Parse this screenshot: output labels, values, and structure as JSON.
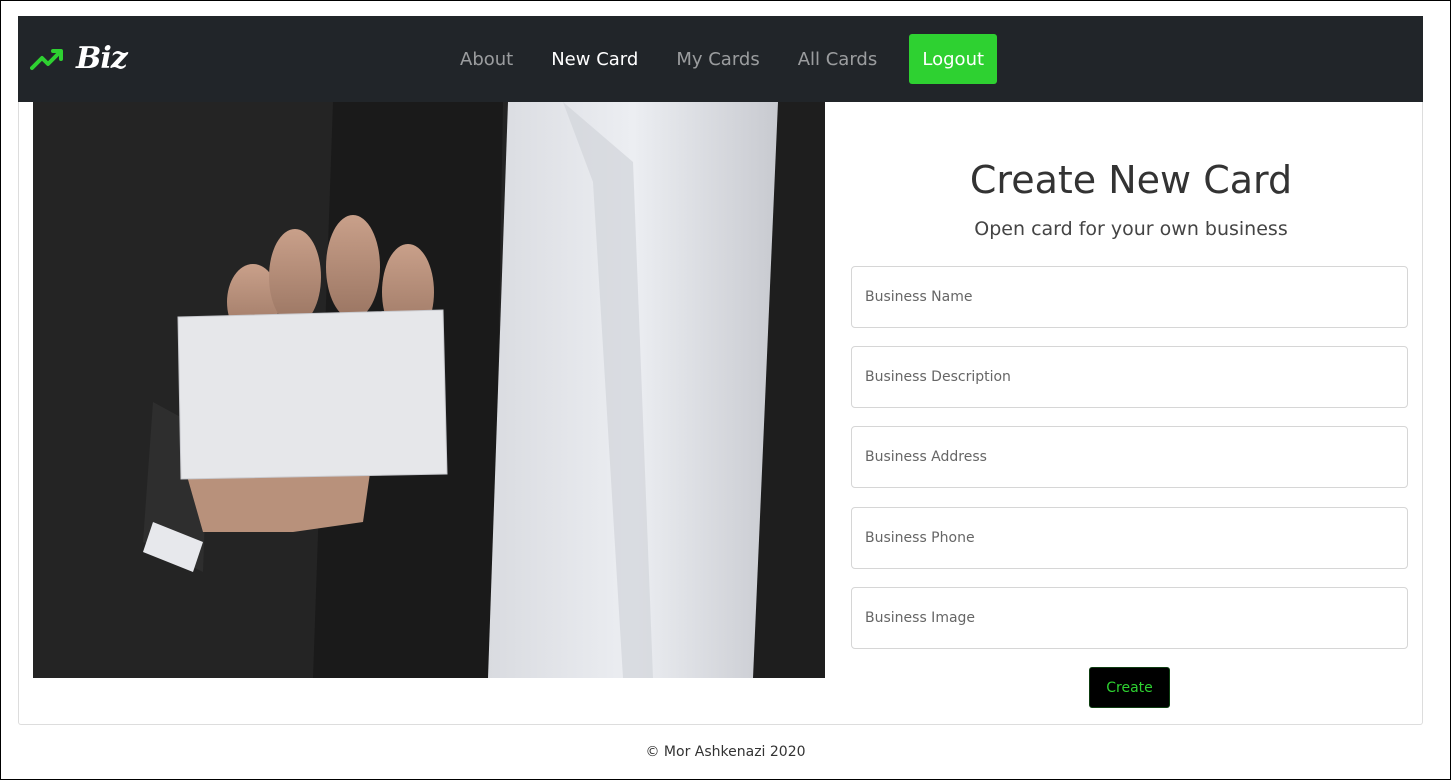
{
  "navbar": {
    "brand": "Biz",
    "brand_icon": "trending-up-icon",
    "links": [
      {
        "label": "About"
      },
      {
        "label": "New Card"
      },
      {
        "label": "My Cards"
      },
      {
        "label": "All Cards"
      }
    ],
    "active_link": "New Card",
    "logout_label": "Logout"
  },
  "form": {
    "title": "Create New Card",
    "subtitle": "Open card for your own business",
    "fields": [
      {
        "placeholder": "Business Name",
        "value": ""
      },
      {
        "placeholder": "Business Description",
        "value": ""
      },
      {
        "placeholder": "Business Address",
        "value": ""
      },
      {
        "placeholder": "Business Phone",
        "value": ""
      },
      {
        "placeholder": "Business Image",
        "value": ""
      }
    ],
    "submit_label": "Create"
  },
  "footer": {
    "text": "© Mor Ashkenazi 2020"
  },
  "colors": {
    "navbar_bg": "#212529",
    "accent": "#2ed131",
    "button_dark": "#000000"
  }
}
